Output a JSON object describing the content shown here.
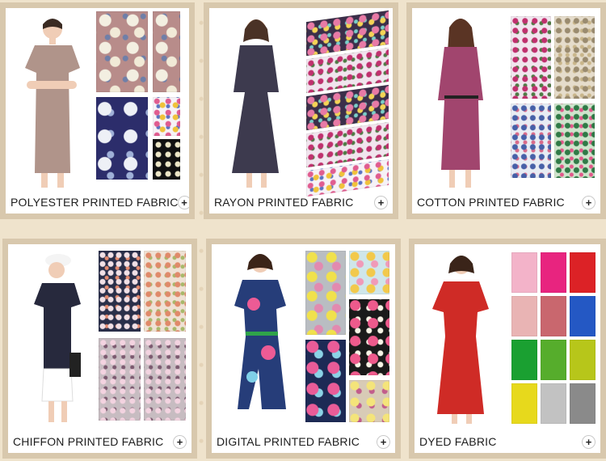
{
  "cards": [
    {
      "label": "POLYESTER PRINTED FABRIC",
      "dress_color": "#b0948a"
    },
    {
      "label": "RAYON PRINTED FABRIC",
      "dress_color": "#3d3a4e"
    },
    {
      "label": "COTTON PRINTED FABRIC",
      "dress_color": "#a1456e"
    },
    {
      "label": "CHIFFON PRINTED FABRIC",
      "dress_color": "#27293d"
    },
    {
      "label": "DIGITAL PRINTED FABRIC",
      "dress_color": "#263d79"
    },
    {
      "label": "DYED FABRIC",
      "dress_color": "#cf2b26"
    }
  ],
  "plus_symbol": "+",
  "dyed_colors": [
    "#f3b3c9",
    "#e8247f",
    "#dc2226",
    "#e9b4b4",
    "#c9676e",
    "#2458c4",
    "#1aa031",
    "#56ad2c",
    "#b7c61a",
    "#e7d91c",
    "#c2c2c2",
    "#8a8a8a"
  ],
  "colors": {
    "background": "#efe3cc",
    "card_frame": "#d8c8ad",
    "card_face": "#ffffff",
    "text": "#1d1d1d"
  }
}
